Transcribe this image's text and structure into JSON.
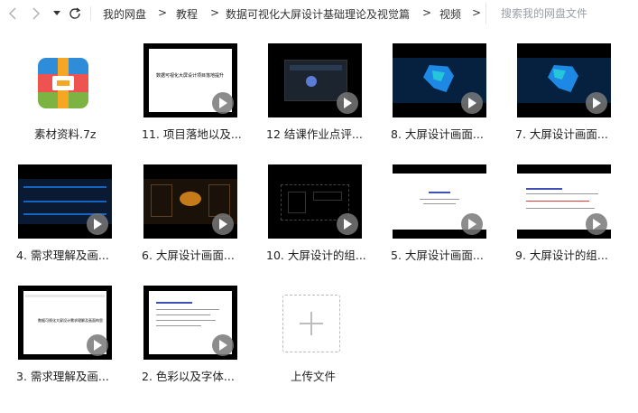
{
  "search": {
    "placeholder": "搜索我的网盘文件"
  },
  "breadcrumb": [
    {
      "label": "我的网盘"
    },
    {
      "label": "教程"
    },
    {
      "label": "数据可视化大屏设计基础理论及视觉篇"
    },
    {
      "label": "视频"
    }
  ],
  "breadcrumb_separator": ">",
  "files": [
    {
      "name": "素材资料.7z",
      "type": "archive"
    },
    {
      "name": "11. 项目落地以及...",
      "type": "video",
      "thumb_title": "数据可视化大屏设计项目落地提升"
    },
    {
      "name": "12 结课作业点评...",
      "type": "video"
    },
    {
      "name": "8. 大屏设计画面...",
      "type": "video"
    },
    {
      "name": "7. 大屏设计画面...",
      "type": "video"
    },
    {
      "name": "4. 需求理解及画...",
      "type": "video"
    },
    {
      "name": "6. 大屏设计画面...",
      "type": "video"
    },
    {
      "name": "10. 大屏设计的组...",
      "type": "video"
    },
    {
      "name": "5. 大屏设计画面...",
      "type": "video"
    },
    {
      "name": "9. 大屏设计的组...",
      "type": "video"
    },
    {
      "name": "3. 需求理解及画...",
      "type": "video",
      "thumb_title": "数据可视化大屏设计需求理解及画面构思"
    },
    {
      "name": "2. 色彩以及字体...",
      "type": "video"
    }
  ],
  "upload": {
    "label": "上传文件"
  },
  "icons": {
    "back": "chevron-left-icon",
    "forward": "chevron-right-icon",
    "history": "caret-down-icon",
    "refresh": "refresh-icon",
    "play": "play-icon",
    "archive": "archive-icon",
    "plus": "plus-icon"
  },
  "colors": {
    "accent": "#1a73e8",
    "thumb_bg": "#000000",
    "map_blue": "#1e88e5",
    "map_highlight": "#26c6da"
  }
}
